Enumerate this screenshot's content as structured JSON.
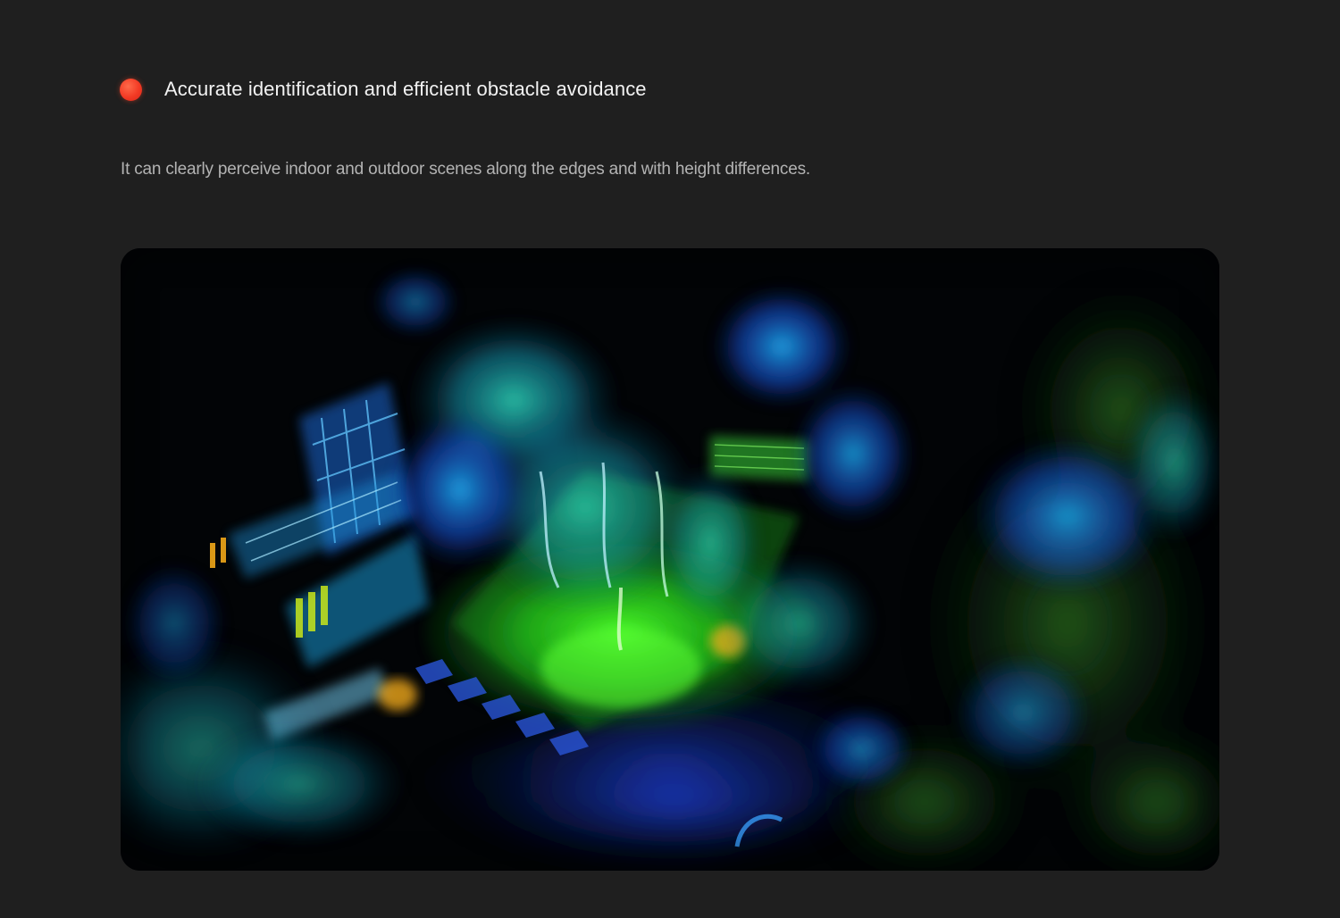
{
  "feature": {
    "bullet_color": "#f2402a",
    "title": "Accurate identification and efficient obstacle avoidance",
    "description": "It can clearly perceive indoor and outdoor scenes along the edges and with height differences."
  },
  "visual": {
    "subject": "lidar-point-cloud-scene",
    "palette": [
      "#0a1a6a",
      "#1b5cff",
      "#1fb7ff",
      "#19d98a",
      "#31e016",
      "#c8e61a",
      "#ffb21a"
    ]
  }
}
